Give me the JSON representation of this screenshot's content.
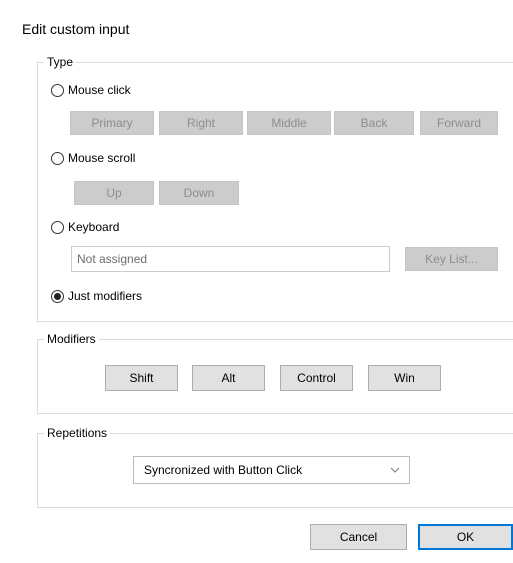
{
  "dialog": {
    "title": "Edit custom input"
  },
  "type_group": {
    "label": "Type",
    "mouse_click": {
      "label": "Mouse click",
      "checked": false,
      "buttons": [
        "Primary",
        "Right",
        "Middle",
        "Back",
        "Forward"
      ]
    },
    "mouse_scroll": {
      "label": "Mouse scroll",
      "checked": false,
      "buttons": [
        "Up",
        "Down"
      ]
    },
    "keyboard": {
      "label": "Keyboard",
      "checked": false,
      "input_value": "Not assigned",
      "key_list_button": "Key List..."
    },
    "just_modifiers": {
      "label": "Just modifiers",
      "checked": true
    }
  },
  "modifiers_group": {
    "label": "Modifiers",
    "buttons": [
      "Shift",
      "Alt",
      "Control",
      "Win"
    ]
  },
  "repetitions_group": {
    "label": "Repetitions",
    "selected": "Syncronized with Button Click"
  },
  "footer": {
    "cancel_label": "Cancel",
    "ok_label": "OK"
  },
  "colors": {
    "accent": "#0078d7",
    "disabled_button_bg": "#cccccc",
    "disabled_text": "#8d8d8d",
    "button_bg": "#e1e1e1"
  },
  "icons": {
    "radio": "radio-button-icon",
    "dropdown": "chevron-down-icon"
  }
}
